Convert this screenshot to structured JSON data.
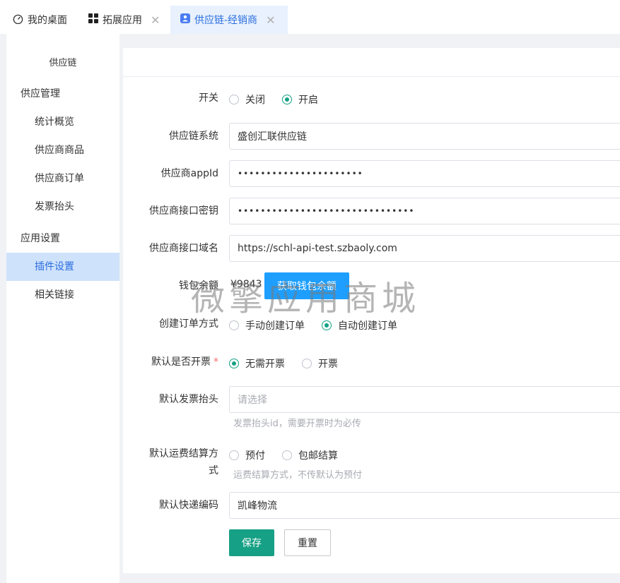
{
  "tabs": [
    {
      "label": "我的桌面",
      "icon": "dashboard-icon",
      "closable": false,
      "active": false
    },
    {
      "label": "拓展应用",
      "icon": "grid-icon",
      "closable": true,
      "active": false
    },
    {
      "label": "供应链-经销商",
      "icon": "user-badge-icon",
      "closable": true,
      "active": true
    }
  ],
  "sidebar": {
    "title": "供应链",
    "groups": [
      {
        "label": "供应管理",
        "items": [
          "统计概览",
          "供应商商品",
          "供应商订单",
          "发票抬头"
        ]
      },
      {
        "label": "应用设置",
        "items": [
          "插件设置",
          "相关链接"
        ]
      }
    ],
    "active_item": "插件设置"
  },
  "form": {
    "switch": {
      "label": "开关",
      "options": [
        "关闭",
        "开启"
      ],
      "selected": "开启"
    },
    "system": {
      "label": "供应链系统",
      "value": "盛创汇联供应链"
    },
    "appid": {
      "label": "供应商appId",
      "value": "••••••••••••••••••••••"
    },
    "secret": {
      "label": "供应商接口密钥",
      "value": "•••••••••••••••••••••••••••••••"
    },
    "domain": {
      "label": "供应商接口域名",
      "value": "https://schl-api-test.szbaoly.com"
    },
    "wallet": {
      "label": "钱包余额",
      "value": "¥9843",
      "button": "获取钱包余额"
    },
    "order_mode": {
      "label": "创建订单方式",
      "options": [
        "手动创建订单",
        "自动创建订单"
      ],
      "selected": "自动创建订单"
    },
    "invoice_default": {
      "label": "默认是否开票",
      "required_mark": "*",
      "options": [
        "无需开票",
        "开票"
      ],
      "selected": "无需开票"
    },
    "invoice_header": {
      "label": "默认发票抬头",
      "placeholder": "请选择",
      "hint": "发票抬头id，需要开票时为必传"
    },
    "freight": {
      "label_line1": "默认运费结算方",
      "label_line2": "式",
      "options": [
        "预付",
        "包邮结算"
      ],
      "selected": null,
      "hint": "运费结算方式，不传默认为预付"
    },
    "express": {
      "label": "默认快递编码",
      "value": "凯峰物流"
    },
    "save_label": "保存",
    "reset_label": "重置"
  },
  "watermark": "微擎应用商城",
  "colors": {
    "accent": "#16a085",
    "blue": "#1e9fff",
    "active_tab_bg": "#e8f1fd",
    "active_menu_bg": "#cfe2fb"
  }
}
